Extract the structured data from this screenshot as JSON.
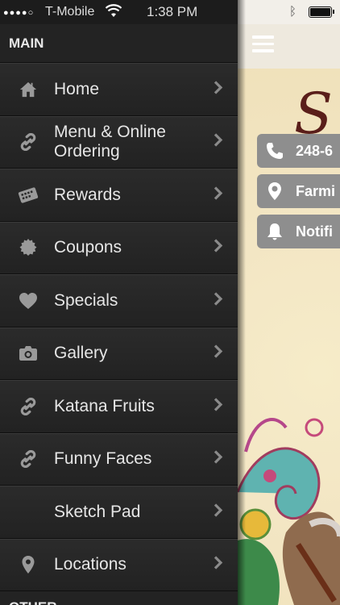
{
  "status_bar": {
    "carrier": "T-Mobile",
    "time": "1:38 PM"
  },
  "drawer": {
    "section_main": "MAIN",
    "section_other": "OTHER",
    "items": [
      {
        "label": "Home",
        "icon": "home-icon"
      },
      {
        "label": "Menu & Online Ordering",
        "icon": "link-icon"
      },
      {
        "label": "Rewards",
        "icon": "card-icon"
      },
      {
        "label": "Coupons",
        "icon": "badge-icon"
      },
      {
        "label": "Specials",
        "icon": "heart-icon"
      },
      {
        "label": "Gallery",
        "icon": "camera-icon"
      },
      {
        "label": "Katana Fruits",
        "icon": "link-icon"
      },
      {
        "label": "Funny Faces",
        "icon": "link-icon"
      },
      {
        "label": "Sketch Pad",
        "icon": ""
      },
      {
        "label": "Locations",
        "icon": "location-pin-icon"
      }
    ]
  },
  "content": {
    "logo_text": "S",
    "pills": [
      {
        "text": "248-6",
        "icon": "phone-icon"
      },
      {
        "text": "Farmi",
        "icon": "location-pin-icon"
      },
      {
        "text": "Notifi",
        "icon": "bell-icon"
      }
    ]
  },
  "colors": {
    "drawer_bg": "#252525",
    "pill_bg": "#8e8e8e",
    "logo": "#5a1e1a"
  }
}
